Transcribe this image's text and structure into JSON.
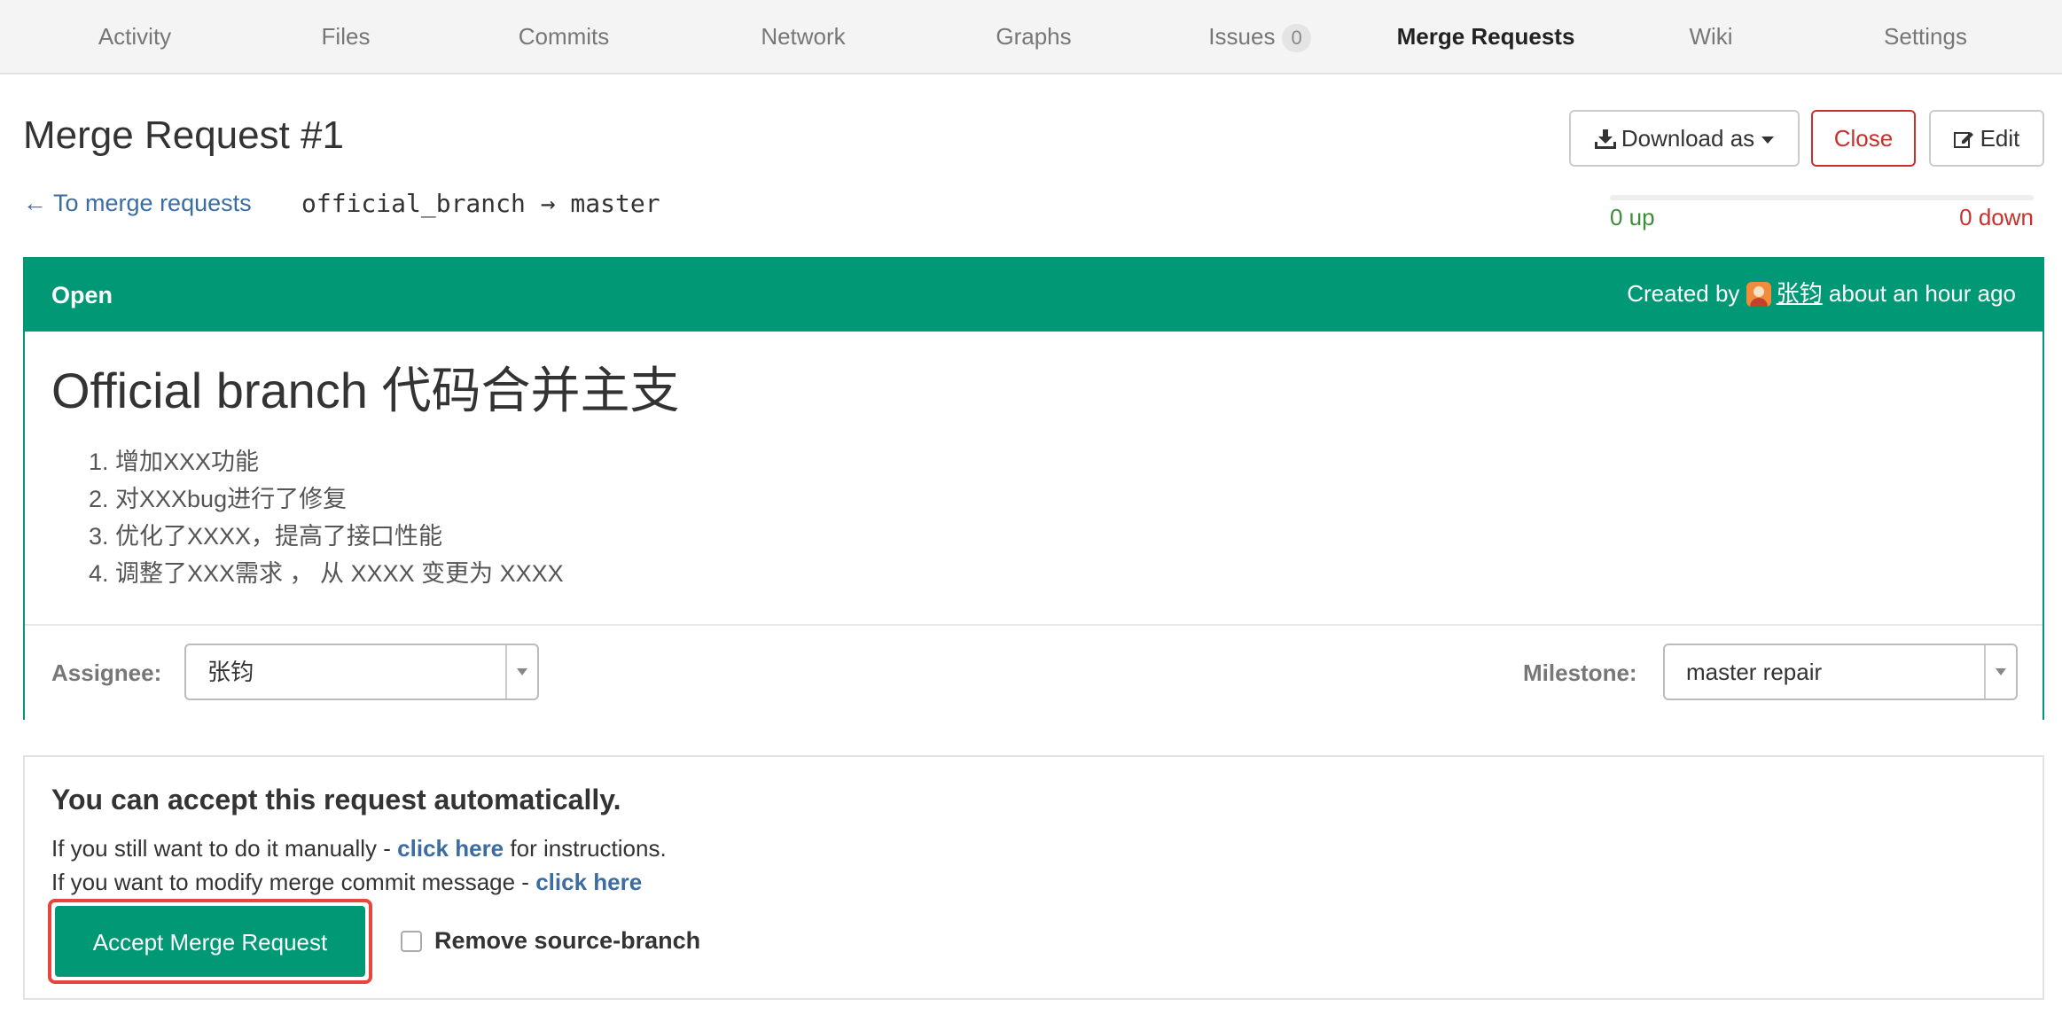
{
  "nav": {
    "items": [
      {
        "label": "Activity"
      },
      {
        "label": "Files"
      },
      {
        "label": "Commits"
      },
      {
        "label": "Network"
      },
      {
        "label": "Graphs"
      },
      {
        "label": "Issues",
        "count": "0"
      },
      {
        "label": "Merge Requests",
        "active": true
      },
      {
        "label": "Wiki"
      },
      {
        "label": "Settings"
      }
    ]
  },
  "header": {
    "title": "Merge Request #1",
    "back_link": "← To merge requests",
    "branch_info": "official_branch → master",
    "download_label": "Download as",
    "close_label": "Close",
    "edit_label": "Edit",
    "votes_up": "0 up",
    "votes_down": "0 down"
  },
  "mr": {
    "status": "Open",
    "created_prefix": "Created by",
    "author": "张钧",
    "created_suffix": "about an hour ago",
    "title": "Official branch 代码合并主支",
    "description": [
      "1. 增加XXX功能",
      "2. 对XXXbug进行了修复",
      "3. 优化了XXXX，提高了接口性能",
      "4. 调整了XXX需求 ， 从 XXXX 变更为 XXXX"
    ],
    "assignee_label": "Assignee:",
    "assignee_value": "张钧",
    "milestone_label": "Milestone:",
    "milestone_value": "master repair"
  },
  "accept": {
    "title": "You can accept this request automatically.",
    "manual_prefix": "If you still want to do it manually - ",
    "manual_link": "click here",
    "manual_suffix": " for instructions.",
    "modify_prefix": "If you want to modify merge commit message - ",
    "modify_link": "click here",
    "button_label": "Accept Merge Request",
    "remove_branch_label": "Remove source-branch"
  },
  "colors": {
    "accent": "#019875",
    "danger": "#c9302c",
    "link": "#3b6da2",
    "highlight": "#e8453c"
  }
}
